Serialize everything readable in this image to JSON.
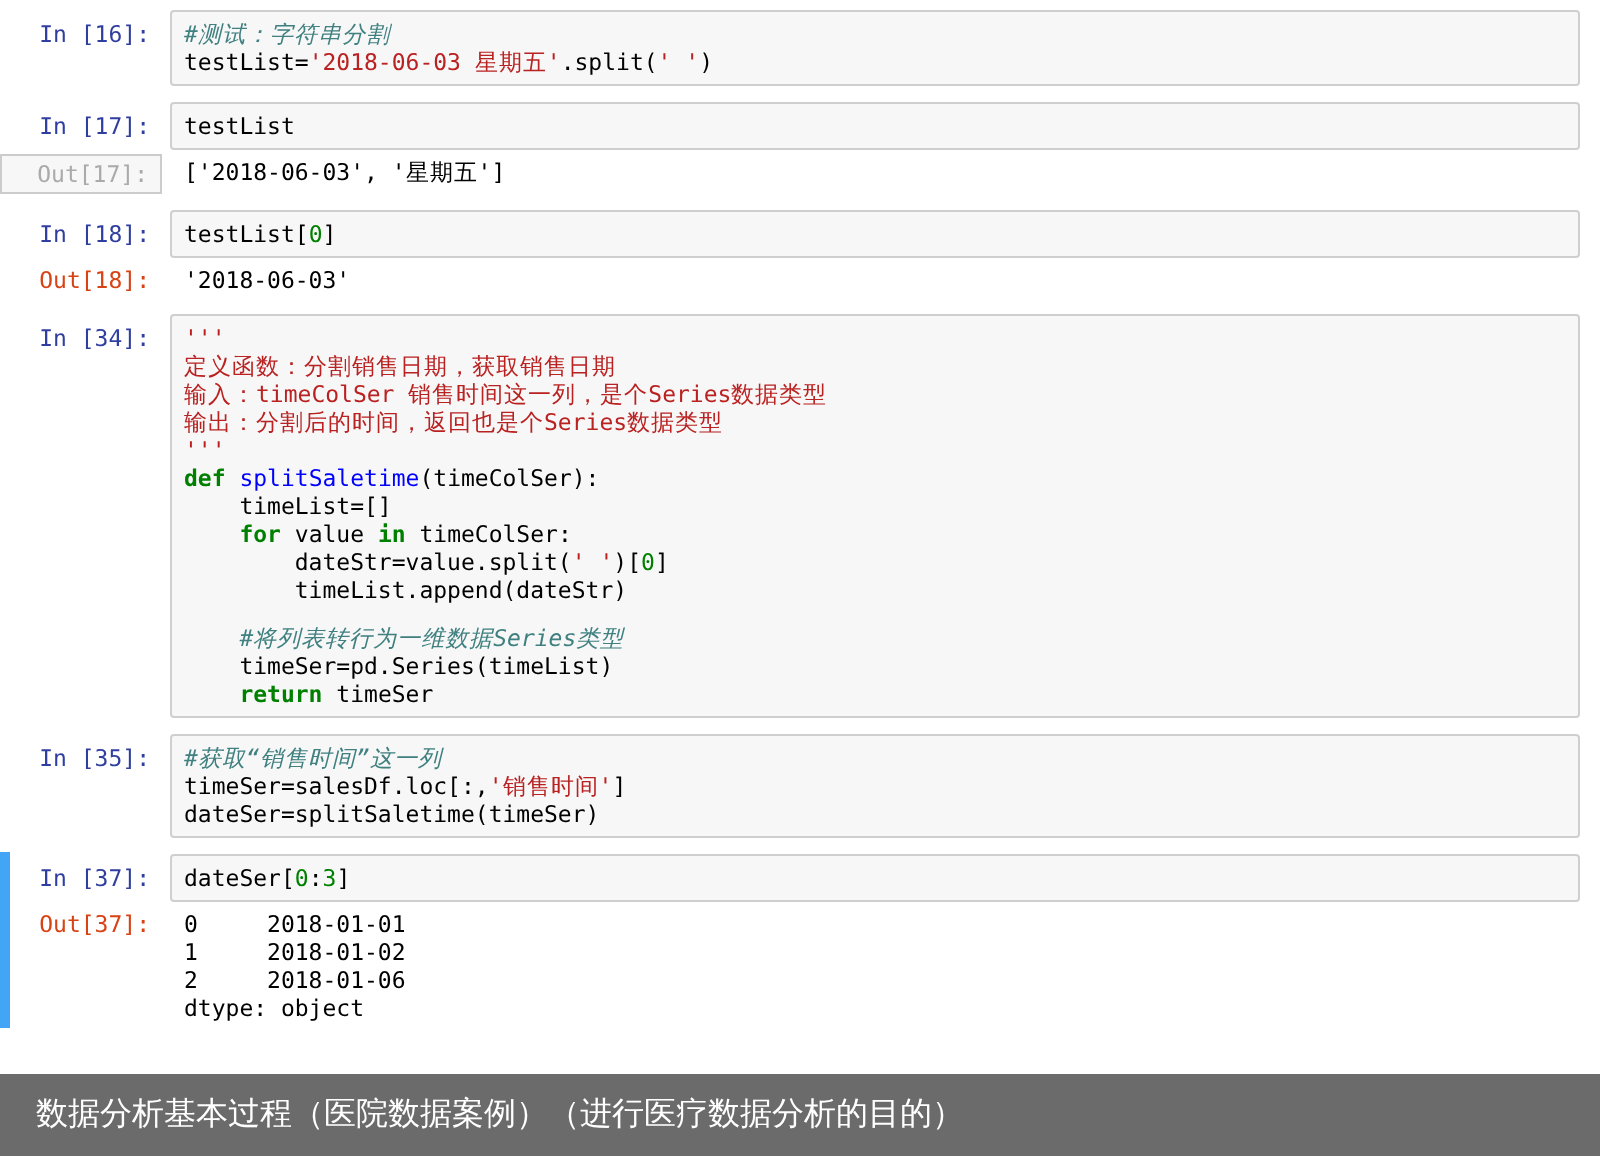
{
  "cells": [
    {
      "prompt": "In [16]:",
      "selected": false,
      "code": [
        [
          {
            "kind": "comment",
            "text": "#测试：字符串分割"
          }
        ],
        [
          {
            "kind": "plain",
            "text": "testList="
          },
          {
            "kind": "string",
            "text": "'2018-06-03 星期五'"
          },
          {
            "kind": "plain",
            "text": ".split("
          },
          {
            "kind": "string",
            "text": "' '"
          },
          {
            "kind": "plain",
            "text": ")"
          }
        ]
      ]
    },
    {
      "prompt": "In [17]:",
      "selected": false,
      "code": [
        [
          {
            "kind": "plain",
            "text": "testList"
          }
        ]
      ],
      "output": {
        "prompt": "Out[17]:",
        "highlighted": true,
        "lines": [
          "['2018-06-03', '星期五']"
        ]
      }
    },
    {
      "prompt": "In [18]:",
      "selected": false,
      "code": [
        [
          {
            "kind": "plain",
            "text": "testList["
          },
          {
            "kind": "number",
            "text": "0"
          },
          {
            "kind": "plain",
            "text": "]"
          }
        ]
      ],
      "output": {
        "prompt": "Out[18]:",
        "highlighted": false,
        "lines": [
          "'2018-06-03'"
        ]
      }
    },
    {
      "prompt": "In [34]:",
      "selected": false,
      "code": [
        [
          {
            "kind": "string",
            "text": "'''"
          }
        ],
        [
          {
            "kind": "string",
            "text": "定义函数：分割销售日期，获取销售日期"
          }
        ],
        [
          {
            "kind": "string",
            "text": "输入：timeColSer 销售时间这一列，是个Series数据类型"
          }
        ],
        [
          {
            "kind": "string",
            "text": "输出：分割后的时间，返回也是个Series数据类型"
          }
        ],
        [
          {
            "kind": "string",
            "text": "'''"
          }
        ],
        [
          {
            "kind": "keyword",
            "text": "def "
          },
          {
            "kind": "function",
            "text": "splitSaletime"
          },
          {
            "kind": "plain",
            "text": "(timeColSer):"
          }
        ],
        [
          {
            "kind": "plain",
            "text": "    timeList=[]"
          }
        ],
        [
          {
            "kind": "keyword",
            "text": "    for"
          },
          {
            "kind": "plain",
            "text": " value "
          },
          {
            "kind": "keyword",
            "text": "in"
          },
          {
            "kind": "plain",
            "text": " timeColSer:"
          }
        ],
        [
          {
            "kind": "plain",
            "text": "        dateStr=value.split("
          },
          {
            "kind": "string",
            "text": "' '"
          },
          {
            "kind": "plain",
            "text": ")["
          },
          {
            "kind": "number",
            "text": "0"
          },
          {
            "kind": "plain",
            "text": "]"
          }
        ],
        [
          {
            "kind": "plain",
            "text": "        timeList.append(dateStr)"
          }
        ],
        [
          {
            "kind": "blank"
          }
        ],
        [
          {
            "kind": "comment",
            "text": "    #将列表转行为一维数据Series类型"
          }
        ],
        [
          {
            "kind": "plain",
            "text": "    timeSer=pd.Series(timeList)"
          }
        ],
        [
          {
            "kind": "keyword",
            "text": "    return"
          },
          {
            "kind": "plain",
            "text": " timeSer"
          }
        ]
      ]
    },
    {
      "prompt": "In [35]:",
      "selected": false,
      "code": [
        [
          {
            "kind": "comment",
            "text": "#获取“销售时间”这一列"
          }
        ],
        [
          {
            "kind": "plain",
            "text": "timeSer=salesDf.loc[:,"
          },
          {
            "kind": "string",
            "text": "'销售时间'"
          },
          {
            "kind": "plain",
            "text": "]"
          }
        ],
        [
          {
            "kind": "plain",
            "text": "dateSer=splitSaletime(timeSer)"
          }
        ]
      ]
    },
    {
      "prompt": "In [37]:",
      "selected": true,
      "code": [
        [
          {
            "kind": "plain",
            "text": "dateSer["
          },
          {
            "kind": "number",
            "text": "0"
          },
          {
            "kind": "plain",
            "text": ":"
          },
          {
            "kind": "number",
            "text": "3"
          },
          {
            "kind": "plain",
            "text": "]"
          }
        ]
      ],
      "output": {
        "prompt": "Out[37]:",
        "highlighted": false,
        "lines": [
          "0     2018-01-01",
          "1     2018-01-02",
          "2     2018-01-06",
          "dtype: object"
        ]
      }
    }
  ],
  "caption": "数据分析基本过程（医院数据案例）（进行医疗数据分析的目的）"
}
